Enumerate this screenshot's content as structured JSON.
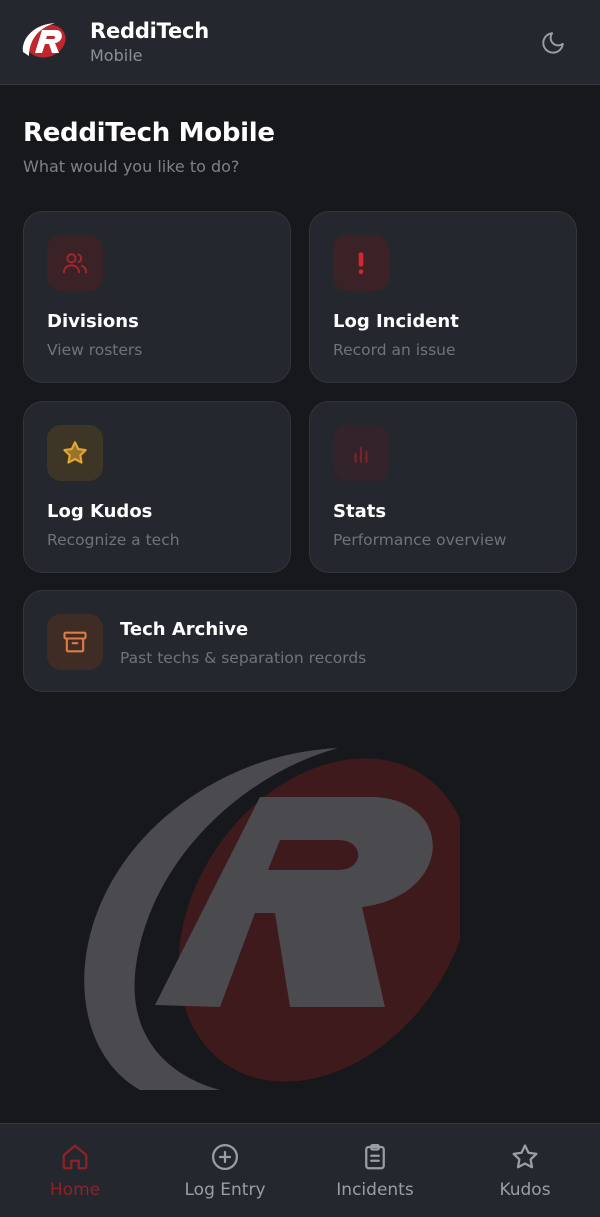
{
  "header": {
    "app_name": "ReddiTech",
    "app_sub": "Mobile",
    "logo_letter": "R",
    "theme_icon": "moon-icon"
  },
  "page": {
    "title": "ReddiTech Mobile",
    "subtitle": "What would you like to do?"
  },
  "cards": {
    "divisions": {
      "title": "Divisions",
      "subtitle": "View rosters",
      "icon": "users-icon"
    },
    "incident": {
      "title": "Log Incident",
      "subtitle": "Record an issue",
      "icon": "exclamation-icon"
    },
    "kudos": {
      "title": "Log Kudos",
      "subtitle": "Recognize a tech",
      "icon": "star-icon"
    },
    "stats": {
      "title": "Stats",
      "subtitle": "Performance overview",
      "icon": "bar-chart-icon"
    },
    "archive": {
      "title": "Tech Archive",
      "subtitle": "Past techs & separation records",
      "icon": "archive-box-icon"
    }
  },
  "nav": {
    "items": [
      {
        "label": "Home",
        "icon": "home-icon",
        "active": true
      },
      {
        "label": "Log Entry",
        "icon": "plus-circle-icon",
        "active": false
      },
      {
        "label": "Incidents",
        "icon": "clipboard-icon",
        "active": false
      },
      {
        "label": "Kudos",
        "icon": "star-icon",
        "active": false
      }
    ]
  },
  "colors": {
    "background": "#17181c",
    "surface": "#25272e",
    "accent_red": "#c0262d",
    "active_nav": "#8f2226",
    "gold": "#e5a632",
    "orange": "#e07b45"
  }
}
